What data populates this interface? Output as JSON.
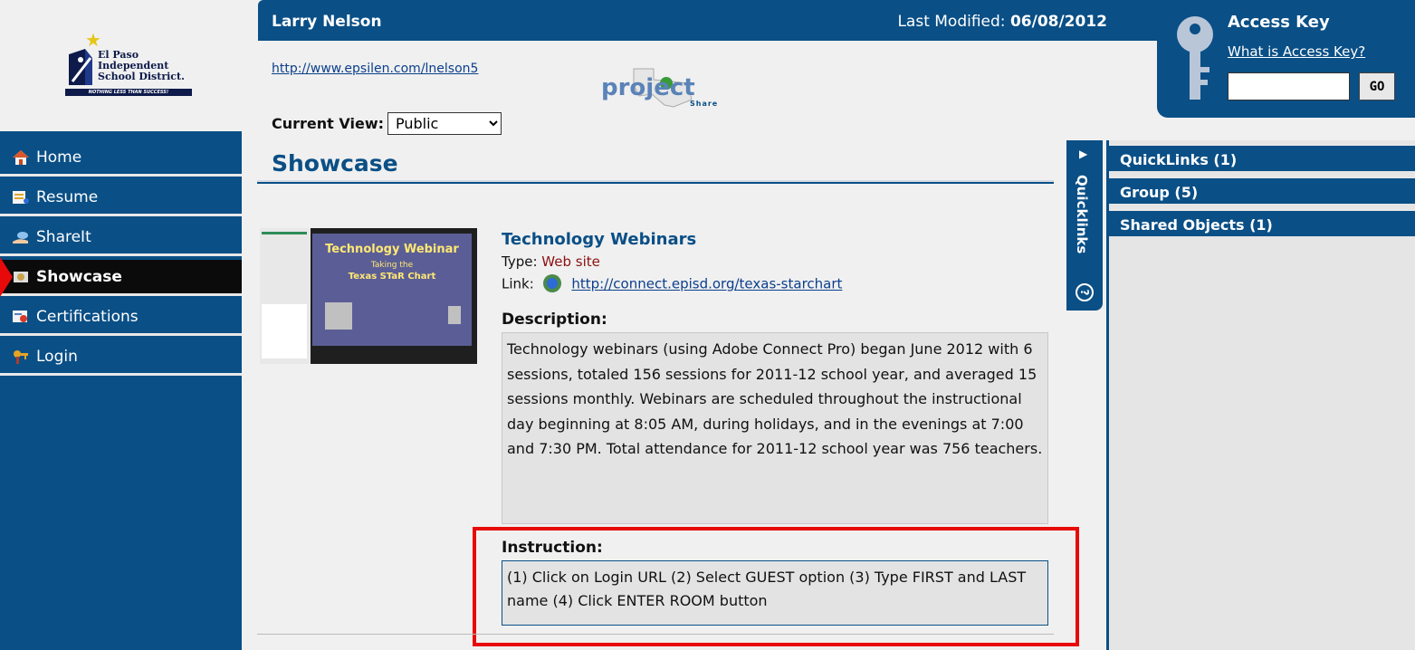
{
  "logo": {
    "district_name_line1": "El Paso",
    "district_name_line2": "Independent",
    "district_name_line3": "School District.",
    "motto": "NOTHING LESS THAN SUCCESS!"
  },
  "sidebar": {
    "items": [
      {
        "label": "Home",
        "icon": "house-icon"
      },
      {
        "label": "Resume",
        "icon": "resume-icon"
      },
      {
        "label": "ShareIt",
        "icon": "share-hand-icon"
      },
      {
        "label": "Showcase",
        "icon": "showcase-icon",
        "active": true
      },
      {
        "label": "Certifications",
        "icon": "certificate-icon"
      },
      {
        "label": "Login",
        "icon": "keys-icon"
      }
    ]
  },
  "header": {
    "user_name": "Larry Nelson",
    "last_modified_label": "Last Modified:",
    "last_modified_date": "06/08/2012",
    "portfolio_url": "http://www.epsilen.com/lnelson5",
    "project_logo_text": "project",
    "project_logo_subtext": "Share"
  },
  "view": {
    "label": "Current View:",
    "selected": "Public"
  },
  "access_key": {
    "title": "Access Key",
    "help_link": "What is Access Key?",
    "input_value": "",
    "go_label": "GO"
  },
  "page_title": "Showcase",
  "item": {
    "title": "Technology Webinars",
    "type_label": "Type:",
    "type_value": "Web site",
    "link_label": "Link:",
    "link_url": "http://connect.episd.org/texas-starchart",
    "thumb_title": "Technology Webinar",
    "thumb_sub1": "Taking the",
    "thumb_sub2": "Texas STaR Chart",
    "description_label": "Description:",
    "description": "Technology webinars (using Adobe Connect Pro) began June 2012 with 6 sessions, totaled 156 sessions for 2011-12 school year, and averaged 15 sessions monthly. Webinars are scheduled throughout the instructional day beginning at 8:05 AM, during holidays, and in the evenings at 7:00 and 7:30 PM. Total attendance for 2011-12 school year was 756 teachers.",
    "instruction_label": "Instruction:",
    "instruction": "(1) Click on Login URL (2) Select GUEST option (3) Type FIRST and LAST name (4) Click ENTER ROOM button"
  },
  "quicklinks_tab": {
    "label": "Quicklinks",
    "help": "?"
  },
  "right_panel": {
    "items": [
      {
        "label": "QuickLinks (1)"
      },
      {
        "label": "Group (5)"
      },
      {
        "label": "Shared Objects (1)"
      }
    ]
  },
  "colors": {
    "brand_blue": "#0a4f86",
    "active_nav": "#0b0b0b",
    "highlight_red": "#e80a0a",
    "type_value_red": "#8b1010"
  }
}
